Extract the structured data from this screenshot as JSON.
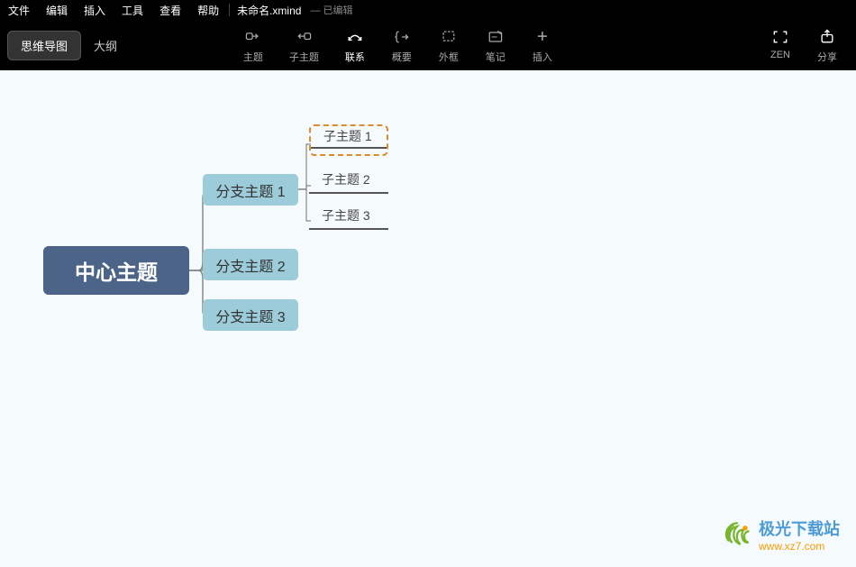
{
  "menu": {
    "items": [
      "文件",
      "编辑",
      "插入",
      "工具",
      "查看",
      "帮助"
    ],
    "filename": "未命名.xmind",
    "edited": "— 已编辑"
  },
  "tabs": {
    "mindmap": "思维导图",
    "outline": "大纲"
  },
  "tools": {
    "topic": "主题",
    "subtopic": "子主题",
    "relationship": "联系",
    "summary": "概要",
    "boundary": "外框",
    "note": "笔记",
    "insert": "插入",
    "zen": "ZEN",
    "share": "分享"
  },
  "mindmap": {
    "central": "中心主题",
    "branches": [
      {
        "label": "分支主题 1",
        "subs": [
          "子主题 1",
          "子主题 2",
          "子主题 3"
        ]
      },
      {
        "label": "分支主题 2"
      },
      {
        "label": "分支主题 3"
      }
    ]
  },
  "watermark": {
    "title": "极光下载站",
    "url": "www.xz7.com"
  }
}
